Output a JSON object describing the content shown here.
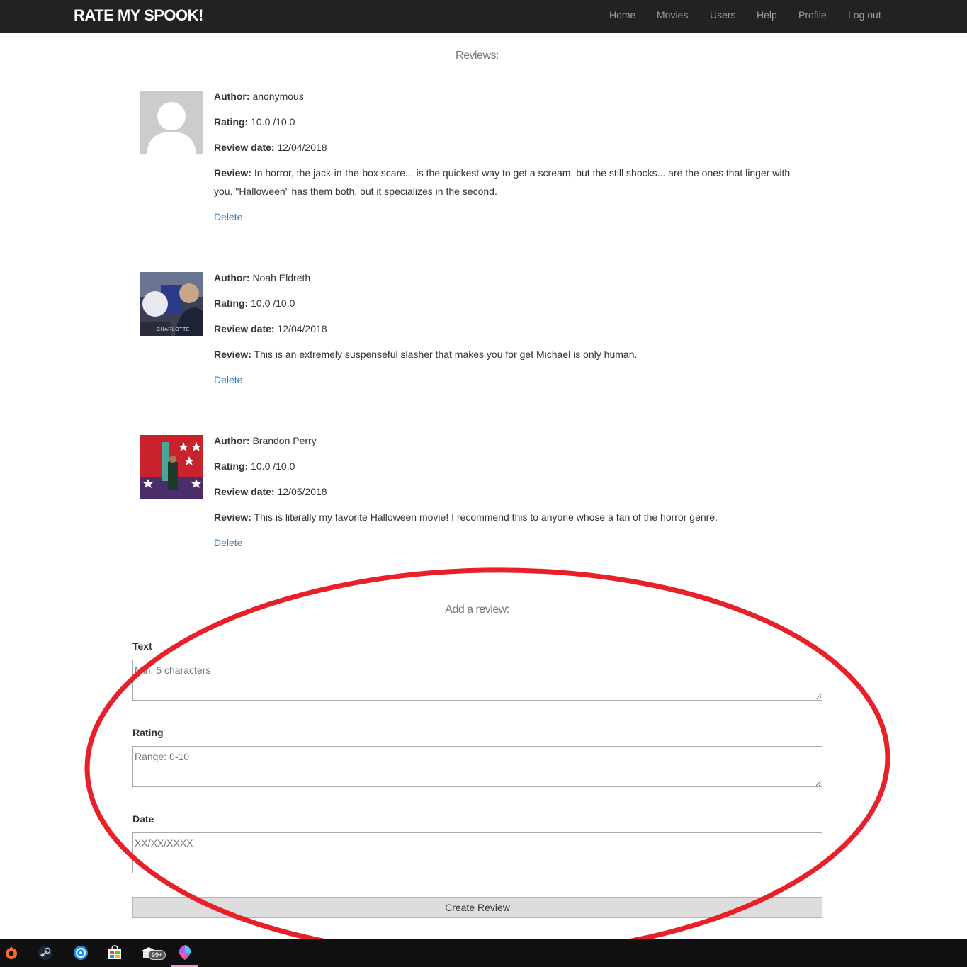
{
  "navbar": {
    "brand": "RATE MY SPOOK!",
    "items": [
      "Home",
      "Movies",
      "Users",
      "Help",
      "Profile",
      "Log out"
    ]
  },
  "reviews_heading": "Reviews:",
  "reviews": [
    {
      "author_label": "Author:",
      "author": "anonymous",
      "rating_label": "Rating:",
      "rating": "10.0 /10.0",
      "date_label": "Review date:",
      "date": "12/04/2018",
      "review_label": "Review:",
      "text": "In horror, the jack-in-the-box scare... is the quickest way to get a scream, but the still shocks... are the ones that linger with you. \"Halloween\" has them both, but it specializes in the second.",
      "delete": "Delete",
      "avatar": "default-user-avatar"
    },
    {
      "author_label": "Author:",
      "author": "Noah Eldreth",
      "rating_label": "Rating:",
      "rating": "10.0 /10.0",
      "date_label": "Review date:",
      "date": "12/04/2018",
      "review_label": "Review:",
      "text": "This is an extremely suspenseful slasher that makes you for get Michael is only human.",
      "delete": "Delete",
      "avatar": "selfie-photo",
      "avatar_caption": "CHARLOTTE"
    },
    {
      "author_label": "Author:",
      "author": "Brandon Perry",
      "rating_label": "Rating:",
      "rating": "10.0 /10.0",
      "date_label": "Review date:",
      "date": "12/05/2018",
      "review_label": "Review:",
      "text": "This is literally my favorite Halloween movie! I recommend this to anyone whose a fan of the horror genre.",
      "delete": "Delete",
      "avatar": "museum-photo"
    }
  ],
  "form": {
    "heading": "Add a review:",
    "text_label": "Text",
    "text_placeholder": "Min: 5 characters",
    "rating_label": "Rating",
    "rating_placeholder": "Range: 0-10",
    "date_label": "Date",
    "date_placeholder": "XX/XX/XXXX",
    "submit": "Create Review"
  },
  "annotation": {
    "color": "#e8202a",
    "shape": "ellipse"
  },
  "taskbar": {
    "icons": [
      "origin-icon",
      "steam-icon",
      "uplay-icon",
      "store-icon",
      "mail-icon",
      "paint-icon"
    ],
    "badge": "99+"
  }
}
